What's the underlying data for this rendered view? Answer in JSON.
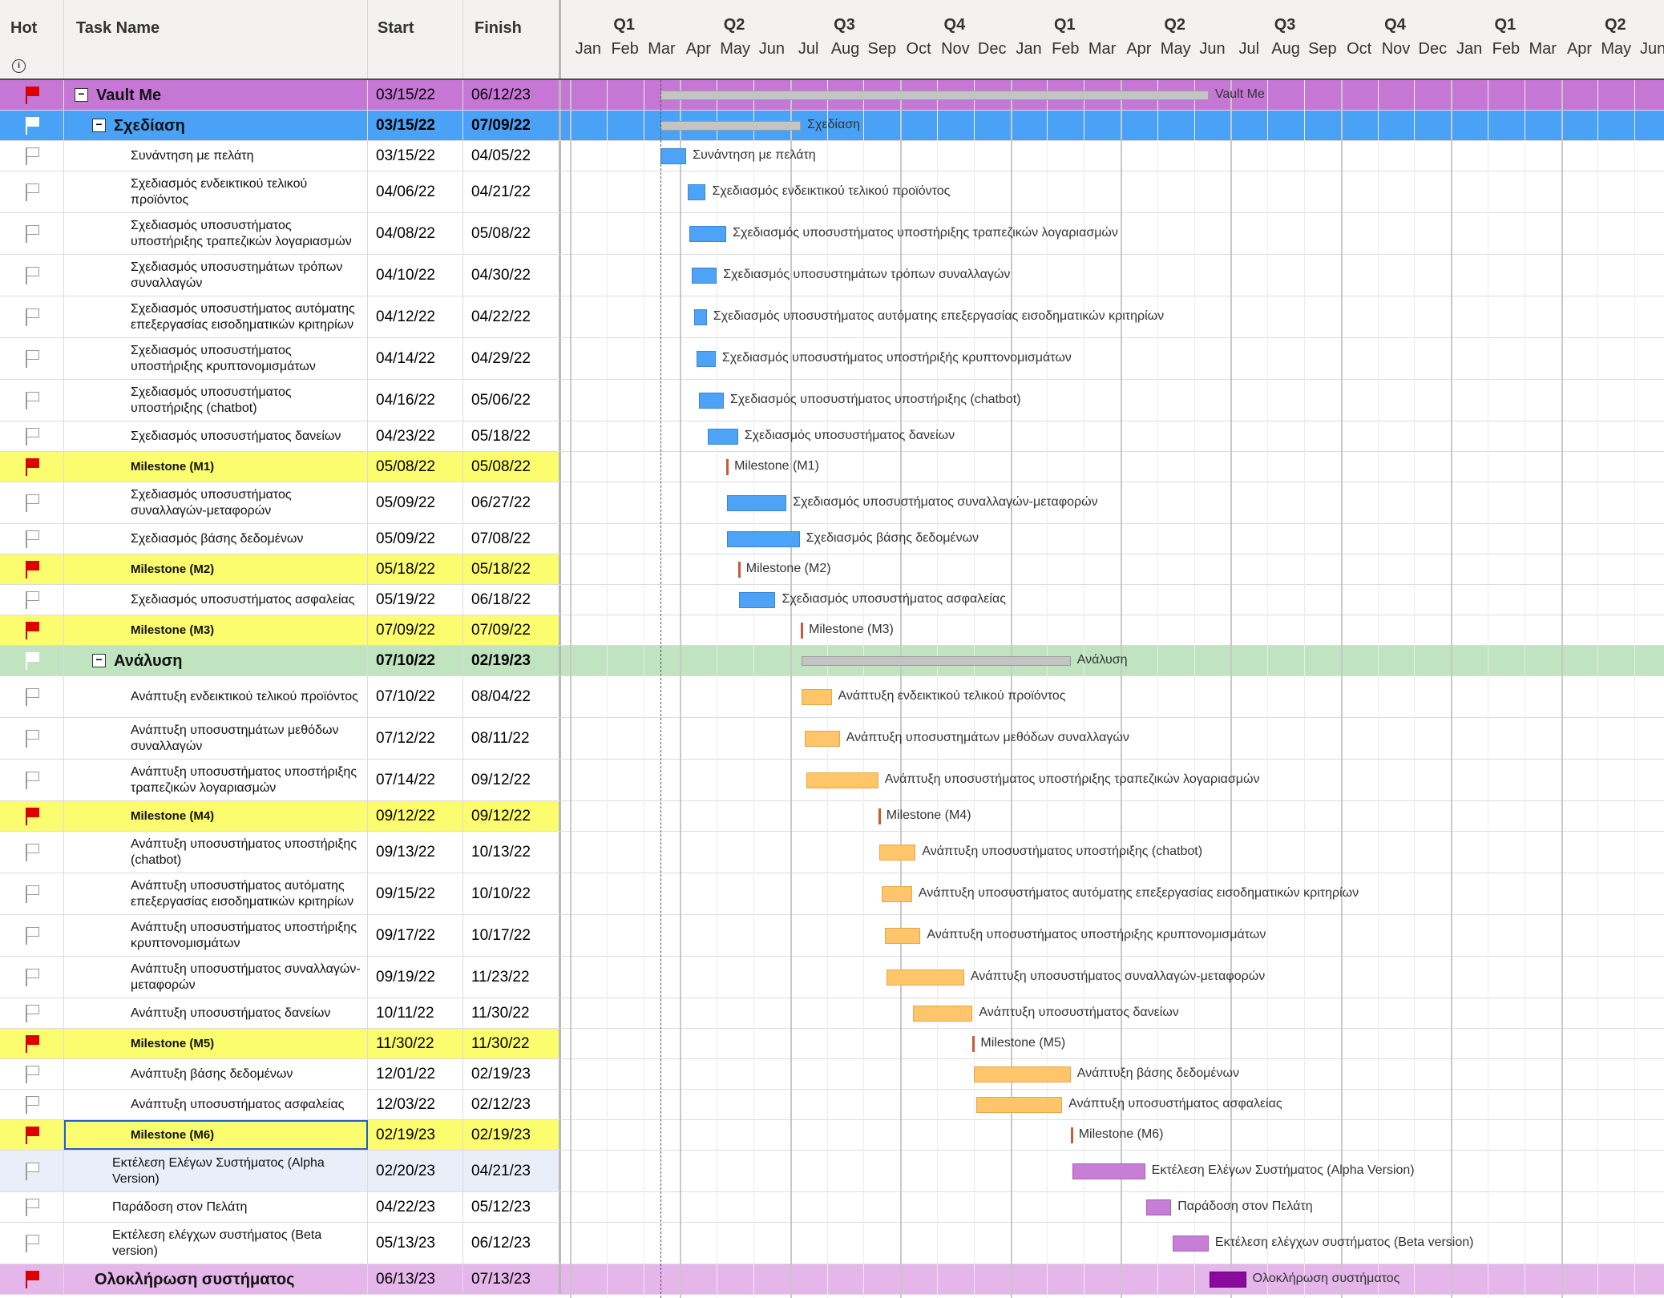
{
  "columns": {
    "hot": "Hot",
    "task_name": "Task Name",
    "start": "Start",
    "finish": "Finish"
  },
  "timeline": {
    "quarters": [
      "Q1",
      "Q2",
      "Q3",
      "Q4",
      "Q1",
      "Q2",
      "Q3",
      "Q4",
      "Q1",
      "Q2"
    ],
    "months": [
      "Jan",
      "Feb",
      "Mar",
      "Apr",
      "May",
      "Jun",
      "Jul",
      "Aug",
      "Sep",
      "Oct",
      "Nov",
      "Dec",
      "Jan",
      "Feb",
      "Mar",
      "Apr",
      "May",
      "Jun",
      "Jul",
      "Aug",
      "Sep",
      "Oct",
      "Nov",
      "Dec",
      "Jan",
      "Feb",
      "Mar",
      "Apr",
      "May",
      "Jun"
    ]
  },
  "rows": [
    {
      "name": "Vault Me",
      "start": "03/15/22",
      "finish": "06/12/23",
      "flag": "red",
      "style": "project",
      "level": "lvl0",
      "collapse": true,
      "bar": "summary",
      "bar_label": "Vault Me",
      "start_month": 2.47,
      "end_month": 17.4
    },
    {
      "name": "Σχεδίαση",
      "start": "03/15/22",
      "finish": "07/09/22",
      "flag": "whitefill",
      "style": "phase-blue",
      "level": "lvl1",
      "collapse": true,
      "bar": "summary",
      "bar_label": "Σχεδίαση",
      "start_month": 2.47,
      "end_month": 6.29
    },
    {
      "name": "Συνάντηση με πελάτη",
      "start": "03/15/22",
      "finish": "04/05/22",
      "flag": "white",
      "style": "plain",
      "level": "lvl2",
      "bar": "blue",
      "bar_label": "Συνάντηση με πελάτη",
      "start_month": 2.47,
      "end_month": 3.17
    },
    {
      "name": "Σχεδιασμός ενδεικτικού τελικού προϊόντος",
      "start": "04/06/22",
      "finish": "04/21/22",
      "flag": "white",
      "style": "plain",
      "level": "lvl2",
      "bar": "blue",
      "bar_label": "Σχεδιασμός ενδεικτικού τελικού προϊόντος",
      "start_month": 3.2,
      "end_month": 3.7
    },
    {
      "name": "Σχεδιασμός υποσυστήματος υποστήριξης τραπεζικών λογαριασμών",
      "start": "04/08/22",
      "finish": "05/08/22",
      "flag": "white",
      "style": "plain",
      "level": "lvl2",
      "bar": "blue",
      "bar_label": "Σχεδιασμός υποσυστήματος υποστήριξης τραπεζικών λογαριασμών",
      "start_month": 3.25,
      "end_month": 4.26
    },
    {
      "name": "Σχεδιασμός υποσυστημάτων τρόπων συναλλαγών",
      "start": "04/10/22",
      "finish": "04/30/22",
      "flag": "white",
      "style": "plain",
      "level": "lvl2",
      "bar": "blue",
      "bar_label": "Σχεδιασμός υποσυστημάτων τρόπων συναλλαγών",
      "start_month": 3.32,
      "end_month": 4.0
    },
    {
      "name": "Σχεδιασμός υποσυστήματος αυτόματης επεξεργασίας εισοδηματικών κριτηρίων",
      "start": "04/12/22",
      "finish": "04/22/22",
      "flag": "white",
      "style": "plain",
      "level": "lvl2",
      "bar": "blue",
      "bar_label": "Σχεδιασμός υποσυστήματος αυτόματης επεξεργασίας εισοδηματικών κριτηρίων",
      "start_month": 3.38,
      "end_month": 3.73
    },
    {
      "name": "Σχεδιασμός υποσυστήματος υποστήριξης κρυπτονομισμάτων",
      "start": "04/14/22",
      "finish": "04/29/22",
      "flag": "white",
      "style": "plain",
      "level": "lvl2",
      "bar": "blue",
      "bar_label": "Σχεδιασμός υποσυστήματος υποστήριξής κρυπτονομισμάτων",
      "start_month": 3.45,
      "end_month": 3.97
    },
    {
      "name": "Σχεδιασμός υποσυστήματος υποστήριξης (chatbot)",
      "start": "04/16/22",
      "finish": "05/06/22",
      "flag": "white",
      "style": "plain",
      "level": "lvl2",
      "bar": "blue",
      "bar_label": "Σχεδιασμός υποσυστήματος υποστήριξης (chatbot)",
      "start_month": 3.52,
      "end_month": 4.19
    },
    {
      "name": "Σχεδιασμός υποσυστήματος δανείων",
      "start": "04/23/22",
      "finish": "05/18/22",
      "flag": "white",
      "style": "plain",
      "level": "lvl2",
      "bar": "blue",
      "bar_label": "Σχεδιασμός υποσυστήματος δανείων",
      "start_month": 3.75,
      "end_month": 4.58
    },
    {
      "name": "Milestone (M1)",
      "start": "05/08/22",
      "finish": "05/08/22",
      "flag": "red",
      "style": "milestone",
      "level": "lvl2",
      "bar": "milestone",
      "bar_label": "Milestone (M1)",
      "start_month": 4.26,
      "end_month": 4.26
    },
    {
      "name": "Σχεδιασμός υποσυστήματος συναλλαγών-μεταφορών",
      "start": "05/09/22",
      "finish": "06/27/22",
      "flag": "white",
      "style": "plain",
      "level": "lvl2",
      "bar": "blue",
      "bar_label": "Σχεδιασμός υποσυστήματος συναλλαγών-μεταφορών",
      "start_month": 4.29,
      "end_month": 5.9
    },
    {
      "name": "Σχεδιασμός βάσης δεδομένων",
      "start": "05/09/22",
      "finish": "07/08/22",
      "flag": "white",
      "style": "plain",
      "level": "lvl2",
      "bar": "blue",
      "bar_label": "Σχεδιασμός βάσης δεδομένων",
      "start_month": 4.29,
      "end_month": 6.26
    },
    {
      "name": "Milestone (M2)",
      "start": "05/18/22",
      "finish": "05/18/22",
      "flag": "red",
      "style": "milestone",
      "level": "lvl2",
      "bar": "milestone",
      "bar_label": "Milestone (M2)",
      "start_month": 4.58,
      "end_month": 4.58
    },
    {
      "name": "Σχεδιασμός υποσυστήματος ασφαλείας",
      "start": "05/19/22",
      "finish": "06/18/22",
      "flag": "white",
      "style": "plain",
      "level": "lvl2",
      "bar": "blue",
      "bar_label": "Σχεδιασμός υποσυστήματος ασφαλείας",
      "start_month": 4.61,
      "end_month": 5.6
    },
    {
      "name": "Milestone (M3)",
      "start": "07/09/22",
      "finish": "07/09/22",
      "flag": "red",
      "style": "milestone",
      "level": "lvl2",
      "bar": "milestone",
      "bar_label": "Milestone (M3)",
      "start_month": 6.29,
      "end_month": 6.29
    },
    {
      "name": "Ανάλυση",
      "start": "07/10/22",
      "finish": "02/19/23",
      "flag": "whitefill",
      "style": "phase-green",
      "level": "lvl1",
      "collapse": true,
      "bar": "summary",
      "bar_label": "Ανάλυση",
      "start_month": 6.32,
      "end_month": 13.64
    },
    {
      "name": "Ανάπτυξη ενδεικτικού τελικού προϊόντος",
      "start": "07/10/22",
      "finish": "08/04/22",
      "flag": "white",
      "style": "plain",
      "level": "lvl2",
      "bar": "orange",
      "bar_label": "Ανάπτυξη ενδεικτικού τελικού προϊόντος",
      "start_month": 6.32,
      "end_month": 7.13
    },
    {
      "name": "Ανάπτυξη υποσυστημάτων μεθόδων συναλλαγών",
      "start": "07/12/22",
      "finish": "08/11/22",
      "flag": "white",
      "style": "plain",
      "level": "lvl2",
      "bar": "orange",
      "bar_label": "Ανάπτυξη υποσυστημάτων μεθόδων συναλλαγών",
      "start_month": 6.39,
      "end_month": 7.35
    },
    {
      "name": "Ανάπτυξη υποσυστήματος υποστήριξης τραπεζικών λογαριασμών",
      "start": "07/14/22",
      "finish": "09/12/22",
      "flag": "white",
      "style": "plain",
      "level": "lvl2",
      "bar": "orange",
      "bar_label": "Ανάπτυξη υποσυστήματος υποστήριξης τραπεζικών λογαριασμών",
      "start_month": 6.45,
      "end_month": 8.4
    },
    {
      "name": "Milestone (M4)",
      "start": "09/12/22",
      "finish": "09/12/22",
      "flag": "red",
      "style": "milestone",
      "level": "lvl2",
      "bar": "milestone",
      "bar_label": "Milestone (M4)",
      "start_month": 8.4,
      "end_month": 8.4
    },
    {
      "name": "Ανάπτυξη υποσυστήματος υποστήριξης (chatbot)",
      "start": "09/13/22",
      "finish": "10/13/22",
      "flag": "white",
      "style": "plain",
      "level": "lvl2",
      "bar": "orange",
      "bar_label": "Ανάπτυξη υποσυστήματος υποστήριξης (chatbot)",
      "start_month": 8.43,
      "end_month": 9.42
    },
    {
      "name": "Ανάπτυξη υποσυστήματος αυτόματης επεξεργασίας εισοδηματικών κριτηρίων",
      "start": "09/15/22",
      "finish": "10/10/22",
      "flag": "white",
      "style": "plain",
      "level": "lvl2",
      "bar": "orange",
      "bar_label": "Ανάπτυξη υποσυστήματος αυτόματης επεξεργασίας εισοδηματικών κριτηρίων",
      "start_month": 8.5,
      "end_month": 9.32
    },
    {
      "name": "Ανάπτυξη υποσυστήματος υποστήριξης κρυπτονομισμάτων",
      "start": "09/17/22",
      "finish": "10/17/22",
      "flag": "white",
      "style": "plain",
      "level": "lvl2",
      "bar": "orange",
      "bar_label": "Ανάπτυξη υποσυστήματος υποστήριξης κρυπτονομισμάτων",
      "start_month": 8.57,
      "end_month": 9.55
    },
    {
      "name": "Ανάπτυξη υποσυστήματος συναλλαγών-μεταφορών",
      "start": "09/19/22",
      "finish": "11/23/22",
      "flag": "white",
      "style": "plain",
      "level": "lvl2",
      "bar": "orange",
      "bar_label": "Ανάπτυξη υποσυστήματος συναλλαγών-μεταφορών",
      "start_month": 8.63,
      "end_month": 10.74
    },
    {
      "name": "Ανάπτυξη υποσυστήματος δανείων",
      "start": "10/11/22",
      "finish": "11/30/22",
      "flag": "white",
      "style": "plain",
      "level": "lvl2",
      "bar": "orange",
      "bar_label": "Ανάπτυξη υποσυστήματος δανείων",
      "start_month": 9.35,
      "end_month": 10.97
    },
    {
      "name": "Milestone (M5)",
      "start": "11/30/22",
      "finish": "11/30/22",
      "flag": "red",
      "style": "milestone",
      "level": "lvl2",
      "bar": "milestone",
      "bar_label": "Milestone (M5)",
      "start_month": 10.97,
      "end_month": 10.97
    },
    {
      "name": "Ανάπτυξη βάσης δεδομένων",
      "start": "12/01/22",
      "finish": "02/19/23",
      "flag": "white",
      "style": "plain",
      "level": "lvl2",
      "bar": "orange",
      "bar_label": "Ανάπτυξη βάσης δεδομένων",
      "start_month": 11.0,
      "end_month": 13.64
    },
    {
      "name": "Ανάπτυξη υποσυστήματος ασφαλείας",
      "start": "12/03/22",
      "finish": "02/12/23",
      "flag": "white",
      "style": "plain",
      "level": "lvl2",
      "bar": "orange",
      "bar_label": "Ανάπτυξη υποσυστήματος ασφαλείας",
      "start_month": 11.06,
      "end_month": 13.41
    },
    {
      "name": "Milestone (M6)",
      "start": "02/19/23",
      "finish": "02/19/23",
      "flag": "red",
      "style": "milestone",
      "level": "lvl2",
      "selected": true,
      "bar": "milestone",
      "bar_label": "Milestone (M6)",
      "start_month": 13.64,
      "end_month": 13.64
    },
    {
      "name": "Εκτέλεση Ελέγων Συστήματος (Alpha Version)",
      "start": "02/20/23",
      "finish": "04/21/23",
      "flag": "white",
      "style": "lightblue",
      "level": "lvl3",
      "bar": "purple",
      "bar_label": "Εκτέλεση Ελέγων Συστήματος (Alpha Version)",
      "start_month": 13.68,
      "end_month": 15.67
    },
    {
      "name": "Παράδοση στον Πελάτη",
      "start": "04/22/23",
      "finish": "05/12/23",
      "flag": "white",
      "style": "plain",
      "level": "lvl3",
      "bar": "purple",
      "bar_label": "Παράδοση στον Πελάτη",
      "start_month": 15.7,
      "end_month": 16.38
    },
    {
      "name": "Εκτέλεση ελέγχων συστήματος (Beta version)",
      "start": "05/13/23",
      "finish": "06/12/23",
      "flag": "white",
      "style": "plain",
      "level": "lvl3",
      "bar": "purple",
      "bar_label": "Εκτέλεση ελέγχων συστήματος (Beta version)",
      "start_month": 16.41,
      "end_month": 17.4
    },
    {
      "name": "Ολοκλήρωση συστήματος",
      "start": "06/13/23",
      "finish": "07/13/23",
      "flag": "red",
      "style": "final",
      "level": "lvl0b",
      "bar": "darkpurple",
      "bar_label": "Ολοκλήρωση συστήματος",
      "start_month": 17.43,
      "end_month": 18.42
    }
  ],
  "colors": {
    "project": "#c677d6",
    "phase-blue": "#4aa2f7",
    "phase-green": "#bfe4bf",
    "milestone": "#fbfc6e",
    "lightblue": "#e8eff9",
    "final": "#e4b6ea",
    "plain": "#ffffff"
  },
  "icons": {
    "info": "info-icon",
    "collapse": "collapse-minus-icon",
    "flag": "flag-icon"
  }
}
